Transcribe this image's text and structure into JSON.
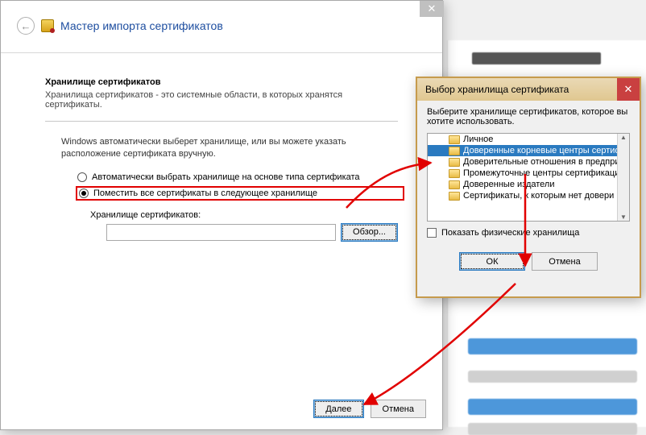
{
  "wizard": {
    "title": "Мастер импорта сертификатов",
    "close_glyph": "✕",
    "back_glyph": "←",
    "section_title": "Хранилище сертификатов",
    "section_desc": "Хранилища сертификатов - это системные области, в которых хранятся сертификаты.",
    "instructions": "Windows автоматически выберет хранилище, или вы можете указать расположение сертификата вручную.",
    "radio_auto": "Автоматически выбрать хранилище на основе типа сертификата",
    "radio_manual": "Поместить все сертификаты в следующее хранилище",
    "store_label": "Хранилище сертификатов:",
    "browse": "Обзор...",
    "next": "Далее",
    "cancel": "Отмена"
  },
  "dialog": {
    "title": "Выбор хранилища сертификата",
    "close_glyph": "✕",
    "instructions": "Выберите хранилище сертификатов, которое вы хотите использовать.",
    "items": [
      "Личное",
      "Доверенные корневые центры сертиф",
      "Доверительные отношения в предпри",
      "Промежуточные центры сертификаци",
      "Доверенные издатели",
      "Сертификаты, к которым нет довери"
    ],
    "show_physical": "Показать физические хранилища",
    "ok": "ОК",
    "cancel": "Отмена"
  }
}
